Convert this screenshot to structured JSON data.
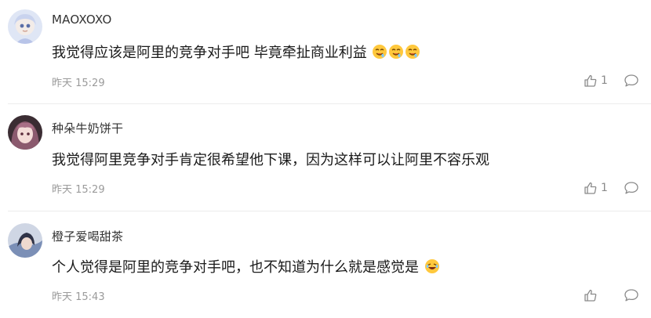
{
  "comments": [
    {
      "username": "MAOXOXO",
      "text": "我觉得应该是阿里的竞争对手吧 毕竟牵扯商业利益",
      "emojis": [
        "drooling-face-emoji",
        "drooling-face-emoji",
        "drooling-face-emoji"
      ],
      "timestamp": "昨天 15:29",
      "likes": "1"
    },
    {
      "username": "种朵牛奶饼干",
      "text": "我觉得阿里竞争对手肯定很希望他下课，因为这样可以让阿里不容乐观",
      "emojis": [],
      "timestamp": "昨天 15:29",
      "likes": "1"
    },
    {
      "username": "橙子爱喝甜茶",
      "text": "个人觉得是阿里的竞争对手吧，也不知道为什么就是感觉是",
      "emojis": [
        "rolling-laughing-emoji"
      ],
      "timestamp": "昨天 15:43",
      "likes": ""
    }
  ],
  "icons": {
    "like": "thumbs-up-icon",
    "reply": "speech-bubble-icon"
  },
  "colors": {
    "meta": "#9a9a9a",
    "divider": "#ececec"
  }
}
